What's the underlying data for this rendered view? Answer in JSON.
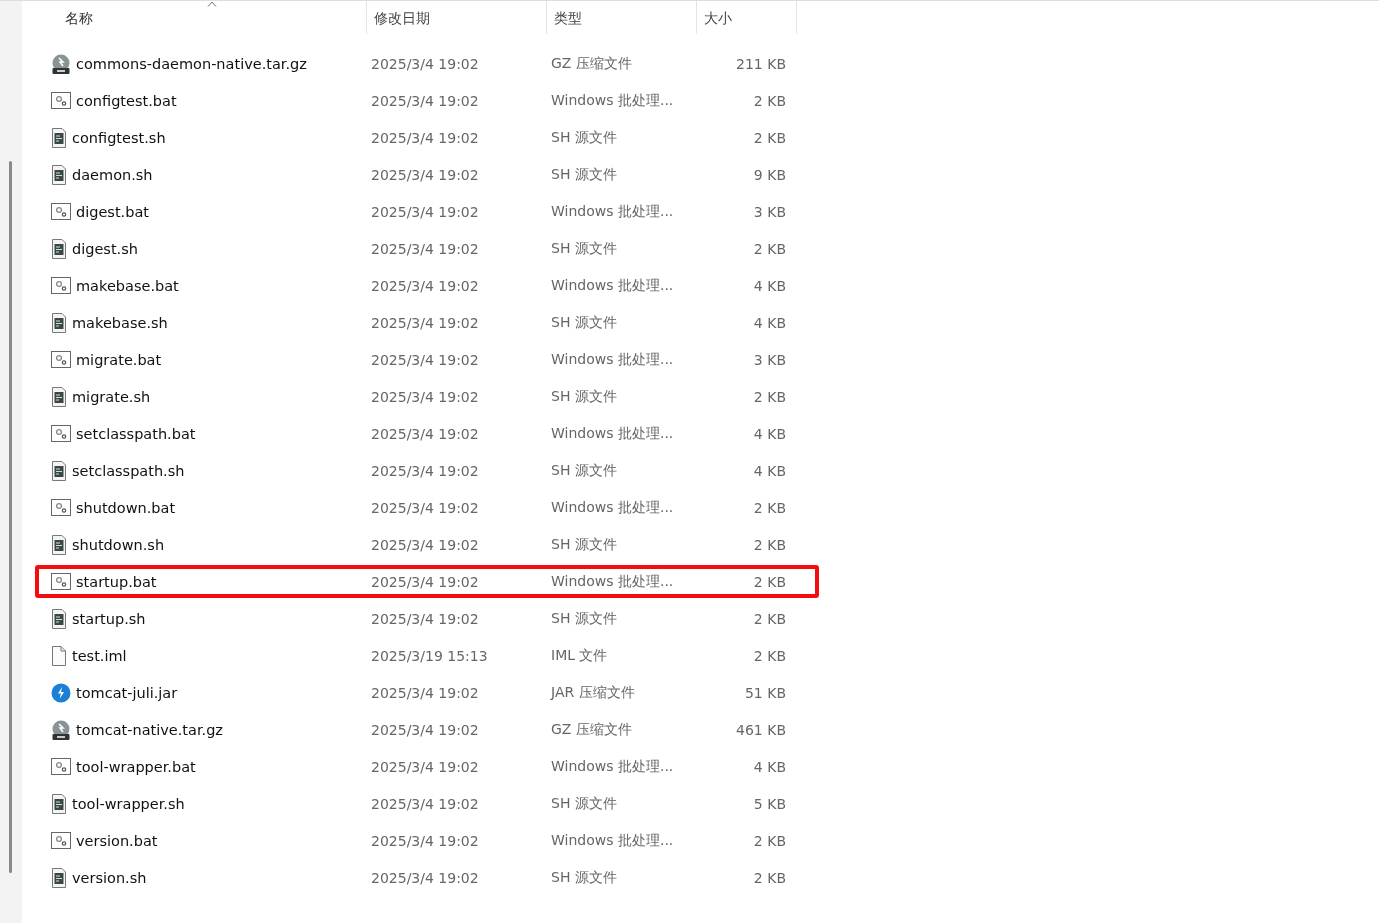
{
  "columns": [
    {
      "label": "名称",
      "sorted": true
    },
    {
      "label": "修改日期",
      "sorted": false
    },
    {
      "label": "类型",
      "sorted": false
    },
    {
      "label": "大小",
      "sorted": false
    }
  ],
  "rows": [
    {
      "kind": "gz",
      "name": "commons-daemon-native.tar.gz",
      "date": "2025/3/4 19:02",
      "type": "GZ 压缩文件",
      "size": "211 KB",
      "highlighted": false
    },
    {
      "kind": "bat",
      "name": "configtest.bat",
      "date": "2025/3/4 19:02",
      "type": "Windows 批处理...",
      "size": "2 KB",
      "highlighted": false
    },
    {
      "kind": "sh",
      "name": "configtest.sh",
      "date": "2025/3/4 19:02",
      "type": "SH 源文件",
      "size": "2 KB",
      "highlighted": false
    },
    {
      "kind": "sh",
      "name": "daemon.sh",
      "date": "2025/3/4 19:02",
      "type": "SH 源文件",
      "size": "9 KB",
      "highlighted": false
    },
    {
      "kind": "bat",
      "name": "digest.bat",
      "date": "2025/3/4 19:02",
      "type": "Windows 批处理...",
      "size": "3 KB",
      "highlighted": false
    },
    {
      "kind": "sh",
      "name": "digest.sh",
      "date": "2025/3/4 19:02",
      "type": "SH 源文件",
      "size": "2 KB",
      "highlighted": false
    },
    {
      "kind": "bat",
      "name": "makebase.bat",
      "date": "2025/3/4 19:02",
      "type": "Windows 批处理...",
      "size": "4 KB",
      "highlighted": false
    },
    {
      "kind": "sh",
      "name": "makebase.sh",
      "date": "2025/3/4 19:02",
      "type": "SH 源文件",
      "size": "4 KB",
      "highlighted": false
    },
    {
      "kind": "bat",
      "name": "migrate.bat",
      "date": "2025/3/4 19:02",
      "type": "Windows 批处理...",
      "size": "3 KB",
      "highlighted": false
    },
    {
      "kind": "sh",
      "name": "migrate.sh",
      "date": "2025/3/4 19:02",
      "type": "SH 源文件",
      "size": "2 KB",
      "highlighted": false
    },
    {
      "kind": "bat",
      "name": "setclasspath.bat",
      "date": "2025/3/4 19:02",
      "type": "Windows 批处理...",
      "size": "4 KB",
      "highlighted": false
    },
    {
      "kind": "sh",
      "name": "setclasspath.sh",
      "date": "2025/3/4 19:02",
      "type": "SH 源文件",
      "size": "4 KB",
      "highlighted": false
    },
    {
      "kind": "bat",
      "name": "shutdown.bat",
      "date": "2025/3/4 19:02",
      "type": "Windows 批处理...",
      "size": "2 KB",
      "highlighted": false
    },
    {
      "kind": "sh",
      "name": "shutdown.sh",
      "date": "2025/3/4 19:02",
      "type": "SH 源文件",
      "size": "2 KB",
      "highlighted": false
    },
    {
      "kind": "bat",
      "name": "startup.bat",
      "date": "2025/3/4 19:02",
      "type": "Windows 批处理...",
      "size": "2 KB",
      "highlighted": true
    },
    {
      "kind": "sh",
      "name": "startup.sh",
      "date": "2025/3/4 19:02",
      "type": "SH 源文件",
      "size": "2 KB",
      "highlighted": false
    },
    {
      "kind": "iml",
      "name": "test.iml",
      "date": "2025/3/19 15:13",
      "type": "IML 文件",
      "size": "2 KB",
      "highlighted": false
    },
    {
      "kind": "jar",
      "name": "tomcat-juli.jar",
      "date": "2025/3/4 19:02",
      "type": "JAR 压缩文件",
      "size": "51 KB",
      "highlighted": false
    },
    {
      "kind": "gz",
      "name": "tomcat-native.tar.gz",
      "date": "2025/3/4 19:02",
      "type": "GZ 压缩文件",
      "size": "461 KB",
      "highlighted": false
    },
    {
      "kind": "bat",
      "name": "tool-wrapper.bat",
      "date": "2025/3/4 19:02",
      "type": "Windows 批处理...",
      "size": "4 KB",
      "highlighted": false
    },
    {
      "kind": "sh",
      "name": "tool-wrapper.sh",
      "date": "2025/3/4 19:02",
      "type": "SH 源文件",
      "size": "5 KB",
      "highlighted": false
    },
    {
      "kind": "bat",
      "name": "version.bat",
      "date": "2025/3/4 19:02",
      "type": "Windows 批处理...",
      "size": "2 KB",
      "highlighted": false
    },
    {
      "kind": "sh",
      "name": "version.sh",
      "date": "2025/3/4 19:02",
      "type": "SH 源文件",
      "size": "2 KB",
      "highlighted": false
    }
  ]
}
